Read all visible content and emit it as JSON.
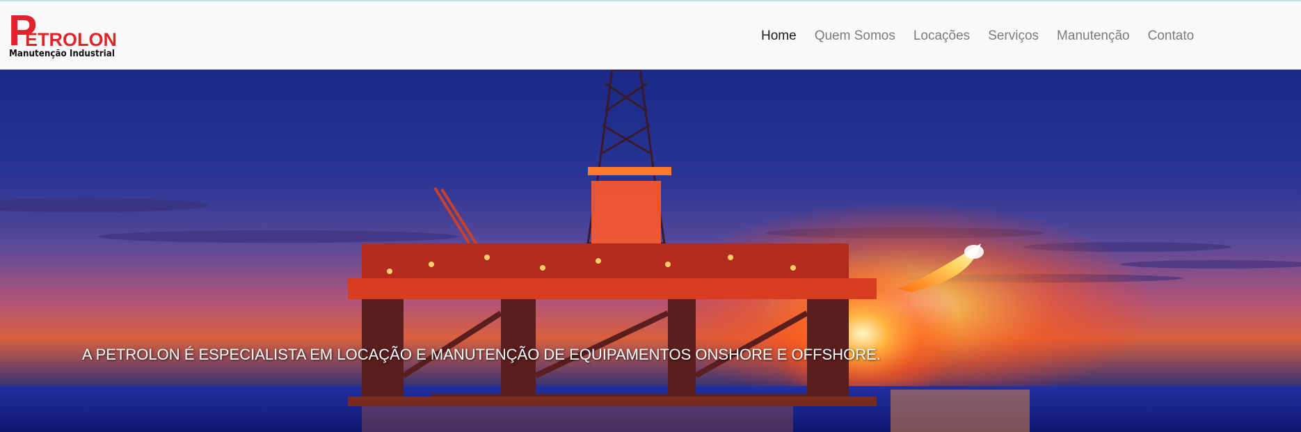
{
  "brand": {
    "logo_initial": "P",
    "logo_word": "ETROLON",
    "logo_subtitle": "Manutenção Industrial",
    "color": "#e0242b"
  },
  "nav": {
    "items": [
      {
        "label": "Home",
        "active": true
      },
      {
        "label": "Quem Somos",
        "active": false
      },
      {
        "label": "Locações",
        "active": false
      },
      {
        "label": "Serviços",
        "active": false
      },
      {
        "label": "Manutenção",
        "active": false
      },
      {
        "label": "Contato",
        "active": false
      }
    ]
  },
  "hero": {
    "image": "offshore-oil-rig-sunset",
    "caption": "A PETROLON É ESPECIALISTA EM LOCAÇÃO E MANUTENÇÃO DE EQUIPAMENTOS ONSHORE E OFFSHORE."
  }
}
